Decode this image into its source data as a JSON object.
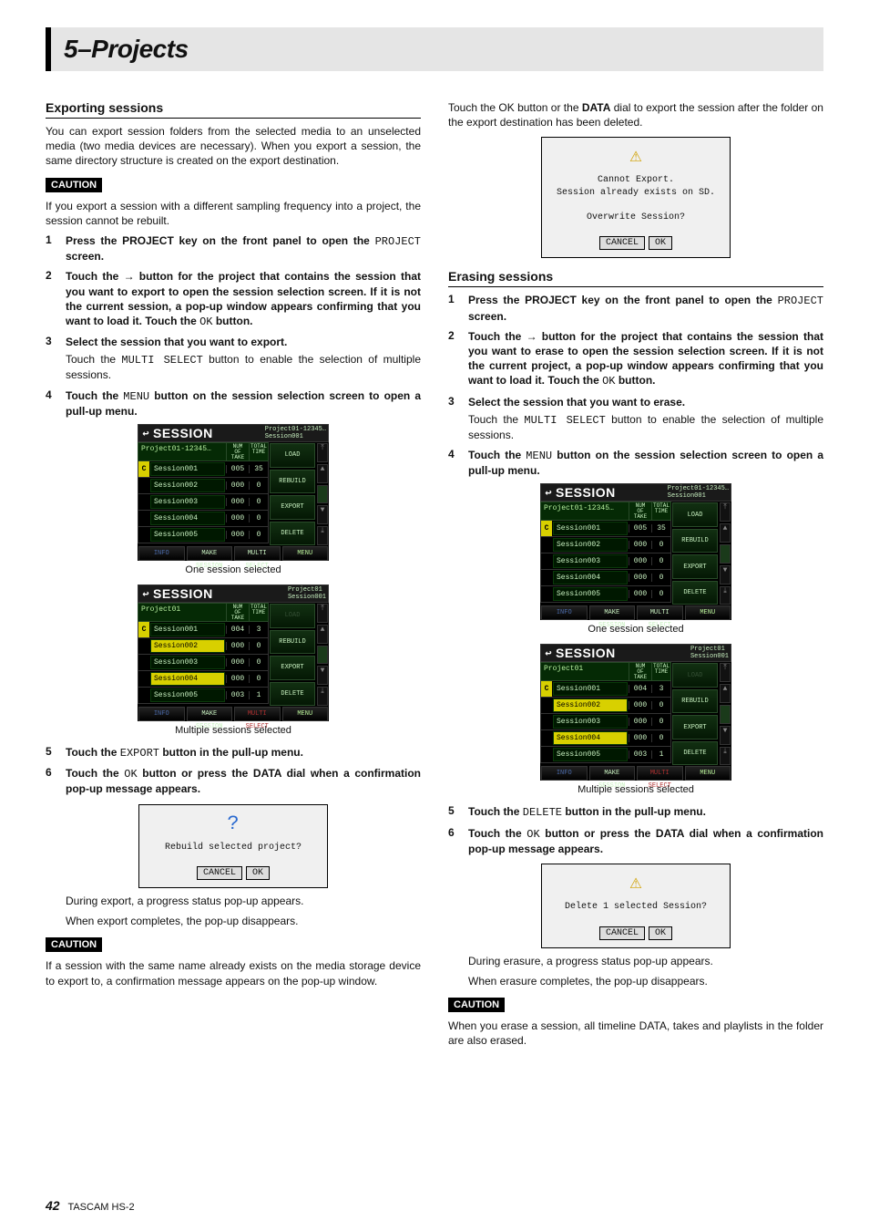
{
  "chapter": "5–Projects",
  "footer": {
    "page": "42",
    "model": "TASCAM  HS-2"
  },
  "export": {
    "heading": "Exporting sessions",
    "intro": "You can export session folders from the selected media to an unselected media (two media devices are necessary). When you export a session, the same directory structure is created on the export destination.",
    "caution1_label": "CAUTION",
    "caution1": "If you export a session with a different sampling frequency into a project, the session cannot be rebuilt.",
    "steps": {
      "s1a": "Press the PROJECT key on the front panel to open the ",
      "s1b": "PROJECT",
      "s1c": " screen.",
      "s2a": "Touch the → button for the project that contains the session that you want to export to open the session selection screen. If it is not the current session, a pop-up window appears confirming that you want to load it. Touch the ",
      "s2b": "OK",
      "s2c": " button.",
      "s3a": "Select the session that you want to export.",
      "s3ba": "Touch the ",
      "s3bb": "MULTI SELECT",
      "s3bc": " button to enable the selection of multiple sessions.",
      "s4a": "Touch the ",
      "s4b": "MENU",
      "s4c": " button on the session selection screen to open a pull-up menu.",
      "s5a": "Touch the ",
      "s5b": "EXPORT",
      "s5c": " button in the pull-up menu.",
      "s6a": "Touch the ",
      "s6b": "OK",
      "s6c": " button or press the DATA dial when a confirmation pop-up message appears."
    },
    "cap_one": "One session selected",
    "cap_multi": "Multiple sessions selected",
    "prog1": "During export, a progress status pop-up appears.",
    "prog2": "When export completes, the pop-up disappears.",
    "caution2_label": "CAUTION",
    "caution2": "If a session with the same name already exists on the media storage device to export to, a confirmation message appears on the pop-up window.",
    "cont1": "Touch the OK button or the ",
    "cont2": "DATA",
    "cont3": " dial to export the session after the folder on the export destination has been deleted."
  },
  "erase": {
    "heading": "Erasing sessions",
    "steps": {
      "s1a": "Press the PROJECT key on the front panel to open the ",
      "s1b": "PROJECT",
      "s1c": " screen.",
      "s2a": "Touch the → button for the project that contains the session that you want to erase to open the session selection screen. If it is not the current project, a pop-up window appears confirming that you want to load it. Touch the ",
      "s2b": "OK",
      "s2c": " button.",
      "s3a": "Select the session that you want to erase.",
      "s3ba": "Touch the ",
      "s3bb": "MULTI SELECT",
      "s3bc": " button to enable the selection of multiple sessions.",
      "s4a": "Touch the ",
      "s4b": "MENU",
      "s4c": " button on the session selection screen to open a pull-up menu.",
      "s5a": "Touch the ",
      "s5b": "DELETE",
      "s5c": " button in the pull-up menu.",
      "s6a": "Touch the ",
      "s6b": "OK",
      "s6c": " button or press the DATA dial when a confirmation pop-up message appears."
    },
    "cap_one": "One session selected",
    "cap_multi": "Multiple sessions selected",
    "prog1": "During erasure, a progress status pop-up appears.",
    "prog2": "When erasure completes, the pop-up disappears.",
    "caution_label": "CAUTION",
    "caution": "When you erase a session, all timeline DATA, takes and playlists in the folder are also erased."
  },
  "screens": {
    "title": "SESSION",
    "sub1a": "Project01-12345…",
    "sub1b": "Session001",
    "sub2a": "Project01",
    "sub2b": "Session001",
    "col1": "NUM\nOF\nTAKE",
    "col2": "TOTAL\nTIME",
    "projA": "Project01-12345…",
    "projB": "Project01",
    "rows": [
      {
        "n": "Session001",
        "a": "005",
        "b": "35"
      },
      {
        "n": "Session002",
        "a": "000",
        "b": "0"
      },
      {
        "n": "Session003",
        "a": "000",
        "b": "0"
      },
      {
        "n": "Session004",
        "a": "000",
        "b": "0"
      },
      {
        "n": "Session005",
        "a": "000",
        "b": "0"
      }
    ],
    "rowsB": [
      {
        "n": "Session001",
        "a": "004",
        "b": "3"
      },
      {
        "n": "Session002",
        "a": "000",
        "b": "0"
      },
      {
        "n": "Session003",
        "a": "000",
        "b": "0"
      },
      {
        "n": "Session004",
        "a": "000",
        "b": "0"
      },
      {
        "n": "Session005",
        "a": "003",
        "b": "1"
      }
    ],
    "btn_load": "LOAD",
    "btn_rebuild": "REBUILD",
    "btn_export": "EXPORT",
    "btn_delete": "DELETE",
    "f_info": "INFO",
    "f_make": "MAKE\nSESSION",
    "f_multi": "MULTI\nSELECT",
    "f_menu": "MENU"
  },
  "dialogs": {
    "rebuild": {
      "icon": "?",
      "msg": "Rebuild selected project?",
      "cancel": "CANCEL",
      "ok": "OK"
    },
    "overwrite": {
      "icon": "⚠",
      "l1": "Cannot Export.",
      "l2": "Session already exists on SD.",
      "l3": "Overwrite Session?",
      "cancel": "CANCEL",
      "ok": "OK"
    },
    "delete": {
      "icon": "⚠",
      "msg": "Delete 1 selected Session?",
      "cancel": "CANCEL",
      "ok": "OK"
    }
  }
}
